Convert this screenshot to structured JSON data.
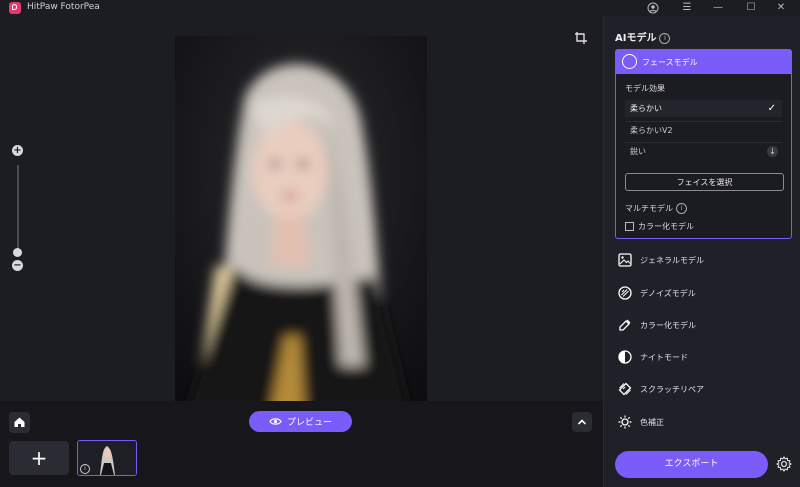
{
  "window": {
    "title": "HitPaw FotorPea",
    "controls": {
      "account": "◯",
      "menu": "☰",
      "minimize": "—",
      "maximize": "☐",
      "close": "✕"
    }
  },
  "canvas": {
    "zoom_in": "+",
    "zoom_out": "−",
    "preview_label": "プレビュー"
  },
  "bottom": {
    "add_label": "+"
  },
  "sidebar": {
    "title": "AIモデル",
    "face_model": {
      "label": "フェースモデル",
      "effect_label": "モデル効果",
      "options": [
        {
          "label": "柔らかい",
          "selected": true
        },
        {
          "label": "柔らかいV2",
          "selected": false
        },
        {
          "label": "鋭い",
          "selected": false
        }
      ],
      "select_face_label": "フェイスを選択",
      "multi_label": "マルチモデル",
      "colorize_label": "カラー化モデル"
    },
    "models": [
      {
        "label": "ジェネラルモデル",
        "icon": "image-icon"
      },
      {
        "label": "デノイズモデル",
        "icon": "denoise-icon"
      },
      {
        "label": "カラー化モデル",
        "icon": "paint-icon"
      },
      {
        "label": "ナイトモード",
        "icon": "half-circle-icon"
      },
      {
        "label": "スクラッチリペア",
        "icon": "bandage-icon"
      },
      {
        "label": "色補正",
        "icon": "sun-icon"
      }
    ],
    "export_label": "エクスポート"
  },
  "colors": {
    "accent": "#7a5cf8",
    "background": "#1c1c23",
    "panel": "#202028"
  }
}
